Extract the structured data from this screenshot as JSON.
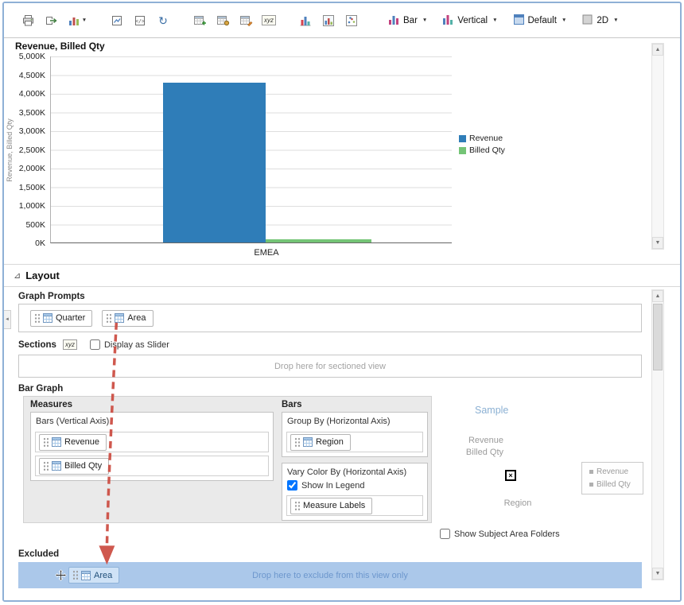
{
  "icons": {
    "dropdown_caret": "▼",
    "refresh_glyph": "↻",
    "xyz_label": "xyz",
    "layout_collapse_glyph": "⊿",
    "scroll_up": "▲",
    "scroll_down": "▼",
    "left_collapse": "◄",
    "x_marker": "×"
  },
  "toolbar": {
    "dropdowns": [
      {
        "label": "Bar"
      },
      {
        "label": "Vertical"
      },
      {
        "label": "Default"
      },
      {
        "label": "2D"
      }
    ]
  },
  "chart_data": {
    "type": "bar",
    "title": "Revenue, Billed Qty",
    "ylabel": "Revenue, Billed Qty",
    "xlabel": "",
    "categories": [
      "EMEA"
    ],
    "series": [
      {
        "name": "Revenue",
        "color": "#2f7db8",
        "values": [
          4300000
        ]
      },
      {
        "name": "Billed Qty",
        "color": "#74c476",
        "values": [
          80000
        ]
      }
    ],
    "ylim": [
      0,
      5000000
    ],
    "y_ticks": [
      "5,000K",
      "4,500K",
      "4,000K",
      "3,500K",
      "3,000K",
      "2,500K",
      "2,000K",
      "1,500K",
      "1,000K",
      "500K",
      "0K"
    ],
    "grid": true,
    "legend_position": "right"
  },
  "layout": {
    "header": "Layout",
    "graph_prompts": {
      "label": "Graph Prompts",
      "items": [
        "Quarter",
        "Area"
      ]
    },
    "sections": {
      "label": "Sections",
      "display_as_slider_label": "Display as Slider",
      "display_as_slider_checked": false,
      "dropzone_text": "Drop here for sectioned view"
    },
    "bar_graph": {
      "label": "Bar Graph",
      "measures": {
        "header": "Measures",
        "box_title": "Bars (Vertical Axis)",
        "items": [
          "Revenue",
          "Billed Qty"
        ]
      },
      "bars": {
        "header": "Bars",
        "group_by_title": "Group By (Horizontal Axis)",
        "group_by_items": [
          "Region"
        ],
        "vary_color_title": "Vary Color By (Horizontal Axis)",
        "show_in_legend_label": "Show In Legend",
        "show_in_legend_checked": true,
        "vary_color_items": [
          "Measure Labels"
        ]
      },
      "sample": {
        "title": "Sample",
        "measure_labels": [
          "Revenue",
          "Billed Qty"
        ],
        "axis_label": "Region",
        "legend_items": [
          "Revenue",
          "Billed Qty"
        ]
      }
    },
    "show_subject_area_folders_label": "Show Subject Area Folders",
    "show_subject_area_folders_checked": false,
    "excluded": {
      "label": "Excluded",
      "dropzone_text": "Drop here to exclude from this view only",
      "dragged_item": "Area"
    }
  }
}
